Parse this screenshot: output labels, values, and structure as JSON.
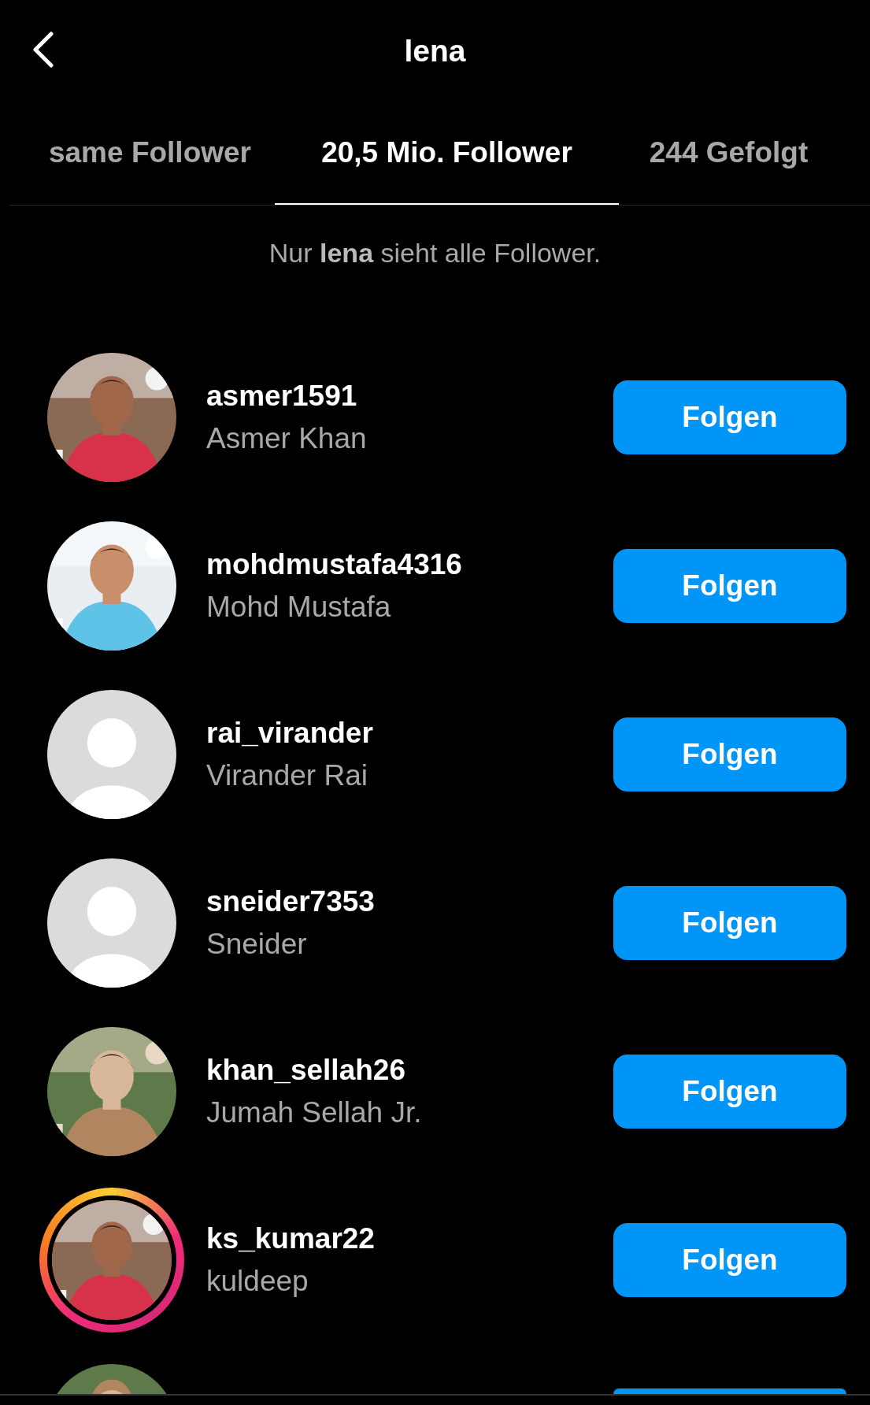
{
  "header": {
    "title": "lena"
  },
  "tabs": [
    {
      "label": "same Follower",
      "selected": false
    },
    {
      "label": "20,5 Mio. Follower",
      "selected": true
    },
    {
      "label": "244 Gefolgt",
      "selected": false
    }
  ],
  "note": "Nur **lena** sieht alle Follower.",
  "followers": [
    {
      "username": "asmer1591",
      "name": "Asmer Khan",
      "story": false,
      "button": "Folgen"
    },
    {
      "username": "mohdmustafa4316",
      "name": "Mohd Mustafa",
      "story": false,
      "button": "Folgen"
    },
    {
      "username": "rai_virander",
      "name": "Virander Rai",
      "kind": "default",
      "story": false,
      "button": "Folgen"
    },
    {
      "username": "sneider7353",
      "name": "Sneider",
      "kind": "default",
      "story": false,
      "button": "Folgen"
    },
    {
      "username": "khan_sellah26",
      "name": "Jumah Sellah Jr.",
      "story": false,
      "button": "Folgen"
    },
    {
      "username": "ks_kumar22",
      "name": "kuldeep",
      "story": true,
      "button": "Folgen"
    }
  ]
}
